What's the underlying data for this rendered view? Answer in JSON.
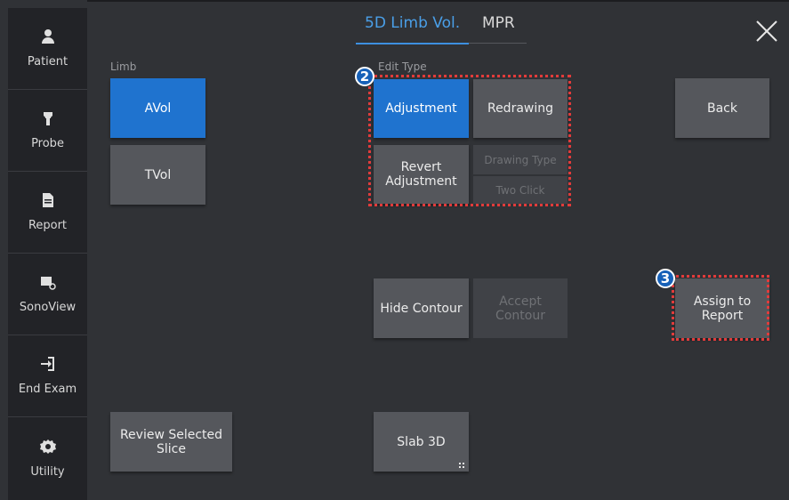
{
  "sidebar": {
    "items": [
      {
        "label": "Patient",
        "icon": "person-icon"
      },
      {
        "label": "Probe",
        "icon": "probe-icon"
      },
      {
        "label": "Report",
        "icon": "document-icon"
      },
      {
        "label": "SonoView",
        "icon": "sonoview-icon"
      },
      {
        "label": "End Exam",
        "icon": "exit-icon"
      },
      {
        "label": "Utility",
        "icon": "gear-icon"
      }
    ]
  },
  "tabs": {
    "active": "5D Limb Vol.",
    "other": "MPR"
  },
  "limb": {
    "label": "Limb",
    "avol": "AVol",
    "tvol": "TVol"
  },
  "edit_type": {
    "label": "Edit Type",
    "adjustment": "Adjustment",
    "redrawing": "Redrawing",
    "revert_line1": "Revert",
    "revert_line2": "Adjustment",
    "drawing_type": "Drawing Type",
    "two_click": "Two Click"
  },
  "actions": {
    "back": "Back",
    "hide_contour": "Hide Contour",
    "accept_line1": "Accept",
    "accept_line2": "Contour",
    "assign_line1": "Assign to",
    "assign_line2": "Report",
    "review_line1": "Review Selected",
    "review_line2": "Slice",
    "slab": "Slab 3D"
  },
  "markers": {
    "m2": "2",
    "m3": "3"
  },
  "colors": {
    "accent": "#1f73cf",
    "highlight": "#e23b3b",
    "tab_active": "#4a9fe8"
  }
}
